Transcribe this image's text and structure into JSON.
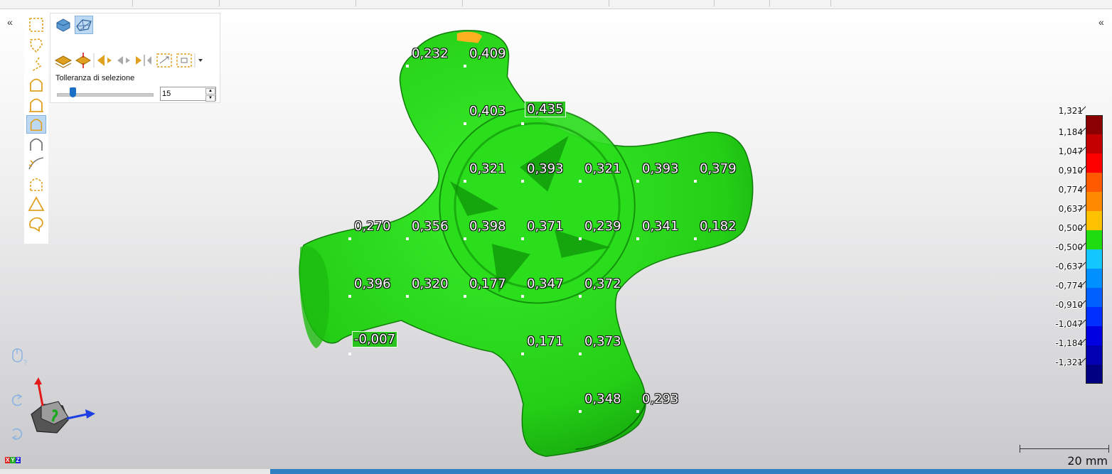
{
  "toolbar": {
    "tolerance_label": "Tolleranza di selezione",
    "tolerance_value": "15"
  },
  "measurements": [
    "0,232",
    "0,409",
    "0,403",
    "0,435",
    "0,321",
    "0,393",
    "0,321",
    "0,393",
    "0,379",
    "0,270",
    "0,356",
    "0,398",
    "0,371",
    "0,239",
    "0,341",
    "0,182",
    "0,396",
    "0,320",
    "0,177",
    "0,347",
    "0,372",
    "-0,007",
    "0,171",
    "0,373",
    "0,348",
    "0,293"
  ],
  "legend": {
    "labels": [
      "1,321",
      "1,184",
      "1,047",
      "0,910",
      "0,774",
      "0,637",
      "0,500",
      "-0,500",
      "-0,637",
      "-0,774",
      "-0,910",
      "-1,047",
      "-1,184",
      "-1,321"
    ],
    "colors": [
      "#8b0000",
      "#c50000",
      "#ff0000",
      "#ff5a00",
      "#ff8a00",
      "#ffc200",
      "#1fdc10",
      "#12c8ff",
      "#0090ff",
      "#0060ff",
      "#0030ff",
      "#0000e0",
      "#0000b0",
      "#000080"
    ]
  },
  "scale_label": "20 mm",
  "axes_label": {
    "x": "X",
    "y": "Y",
    "z": "Z"
  },
  "icons": [
    "rect-select-icon",
    "lasso-select-icon",
    "polyline-select-icon",
    "surface-select-icon",
    "patch-select-icon",
    "brush-select-icon",
    "boundary-select-icon",
    "curvature-select-icon",
    "region-select-icon",
    "triangle-select-icon",
    "freeform-select-icon"
  ],
  "colors": {
    "mesh": "#27d41a",
    "highlight": "#29c41e",
    "accent": "#1a6fc9"
  }
}
